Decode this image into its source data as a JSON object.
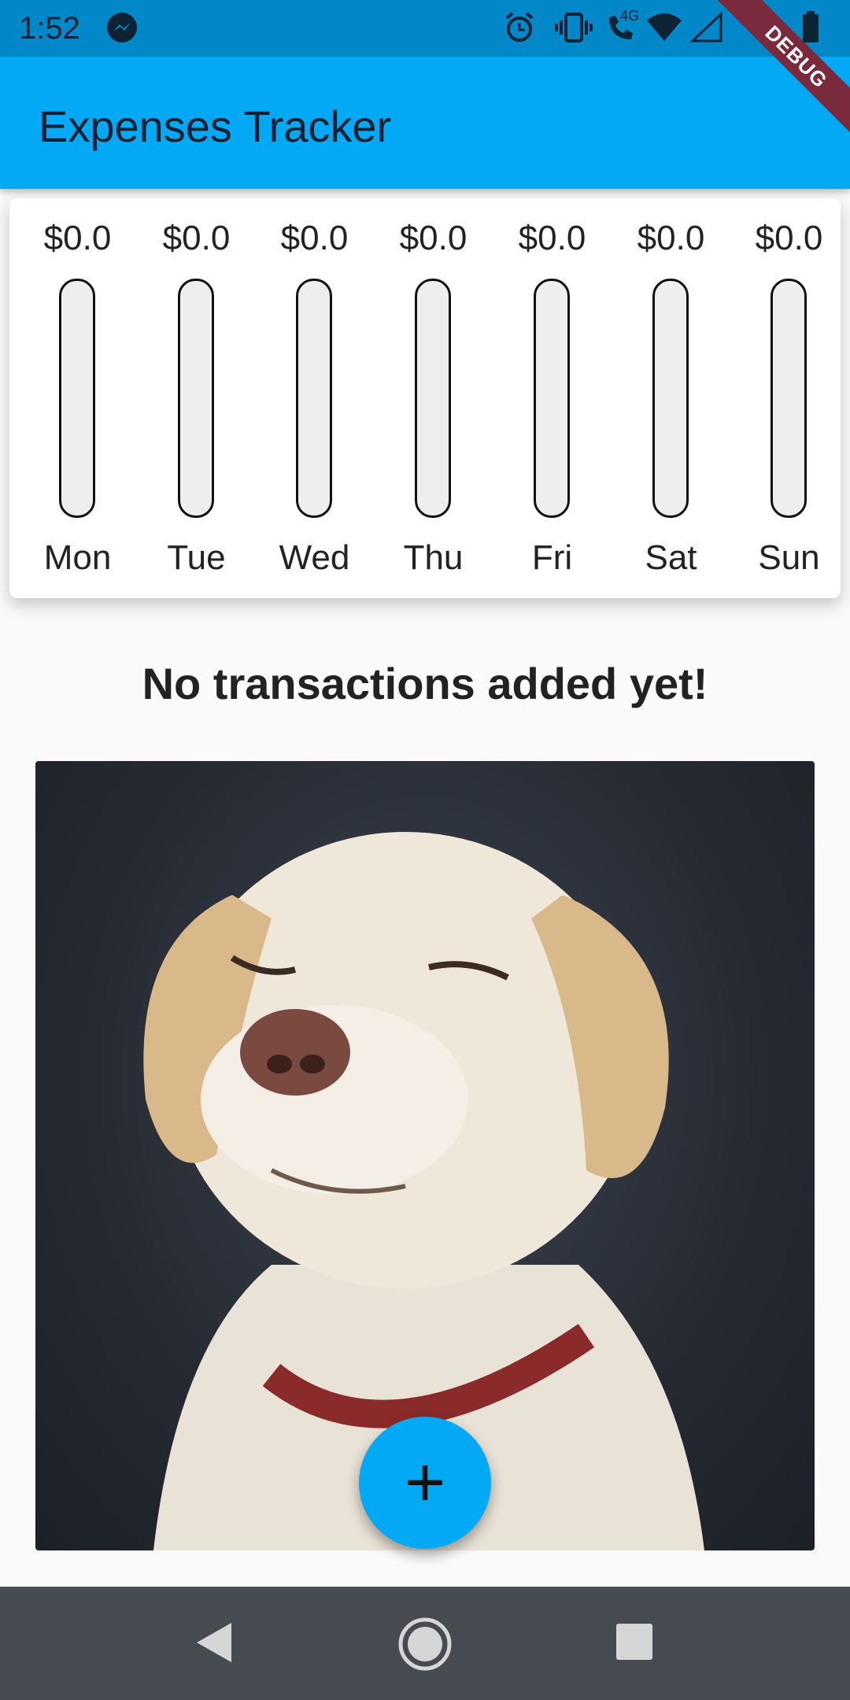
{
  "status_bar": {
    "time": "1:52",
    "icons": [
      "messenger-icon",
      "alarm-icon",
      "vibrate-icon",
      "volte-call-icon",
      "wifi-icon",
      "signal-icon",
      "battery-icon"
    ],
    "network_label": "4G"
  },
  "app_bar": {
    "title": "Expenses Tracker",
    "debug_banner": "DEBUG",
    "color": "#03a9f4"
  },
  "chart": {
    "days": [
      {
        "label": "Mon",
        "amount": "$0.0",
        "fraction": 0
      },
      {
        "label": "Tue",
        "amount": "$0.0",
        "fraction": 0
      },
      {
        "label": "Wed",
        "amount": "$0.0",
        "fraction": 0
      },
      {
        "label": "Thu",
        "amount": "$0.0",
        "fraction": 0
      },
      {
        "label": "Fri",
        "amount": "$0.0",
        "fraction": 0
      },
      {
        "label": "Sat",
        "amount": "$0.0",
        "fraction": 0
      },
      {
        "label": "Sun",
        "amount": "$0.0",
        "fraction": 0
      }
    ]
  },
  "empty_state": {
    "message": "No transactions added yet!",
    "image_icon": "sleeping-dog-photo"
  },
  "fab": {
    "icon": "plus-icon",
    "symbol": "+"
  },
  "nav_bar": {
    "buttons": [
      "back-icon",
      "home-icon",
      "recents-icon"
    ]
  }
}
